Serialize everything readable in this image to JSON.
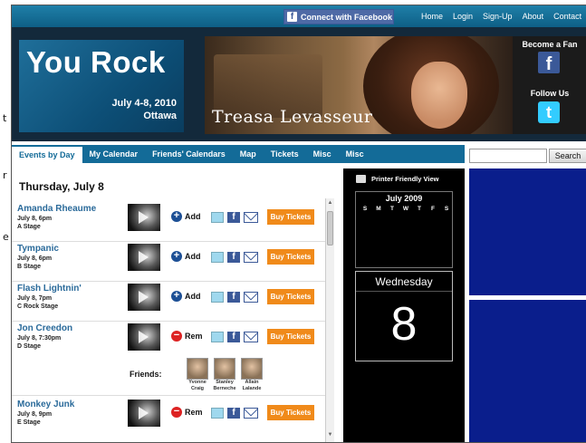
{
  "page_edge": {
    "chars": [
      "t",
      "r",
      "e"
    ]
  },
  "topbar": {
    "facebook_connect": "Connect with Facebook",
    "links": [
      "Home",
      "Login",
      "Sign-Up",
      "About",
      "Contact"
    ]
  },
  "banner": {
    "title": "You Rock",
    "date": "July 4-8, 2010",
    "city": "Ottawa",
    "artist": "Treasa Levasseur",
    "become_fan": "Become a Fan",
    "follow_us": "Follow Us"
  },
  "nav": {
    "tabs": [
      "Events by Day",
      "My Calendar",
      "Friends' Calendars",
      "Map",
      "Tickets",
      "Misc",
      "Misc"
    ],
    "active_tab": "Events by Day",
    "search_button": "Search"
  },
  "day_heading": "Thursday, July 8",
  "events": [
    {
      "name": "Amanda Rheaume",
      "when": "July 8, 6pm",
      "stage": "A Stage",
      "action": "Add",
      "buy": "Buy Tickets"
    },
    {
      "name": "Tympanic",
      "when": "July 8, 6pm",
      "stage": "B Stage",
      "action": "Add",
      "buy": "Buy Tickets"
    },
    {
      "name": "Flash Lightnin'",
      "when": "July 8, 7pm",
      "stage": "C Rock Stage",
      "action": "Add",
      "buy": "Buy Tickets"
    },
    {
      "name": "Jon Creedon",
      "when": "July 8, 7:30pm",
      "stage": "D Stage",
      "action": "Rem",
      "buy": "Buy Tickets"
    },
    {
      "name": "Monkey Junk",
      "when": "July 8, 9pm",
      "stage": "E Stage",
      "action": "Rem",
      "buy": "Buy Tickets"
    }
  ],
  "friends": {
    "label": "Friends:",
    "people": [
      {
        "first": "Yvonne",
        "last": "Craig"
      },
      {
        "first": "Stanley",
        "last": "Berneche"
      },
      {
        "first": "Allain",
        "last": "Lalande"
      }
    ]
  },
  "sidebar": {
    "printer_label": "Printer Friendly View",
    "calendar_month": "July 2009",
    "weekday_headers": [
      "S",
      "M",
      "T",
      "W",
      "T",
      "F",
      "S"
    ],
    "selected_weekday": "Wednesday",
    "selected_day": "8"
  },
  "colors": {
    "nav_blue": "#136b98",
    "buy_orange": "#f08a1a",
    "ad_blue": "#0a1e8c",
    "link_blue": "#2a6a9a"
  }
}
